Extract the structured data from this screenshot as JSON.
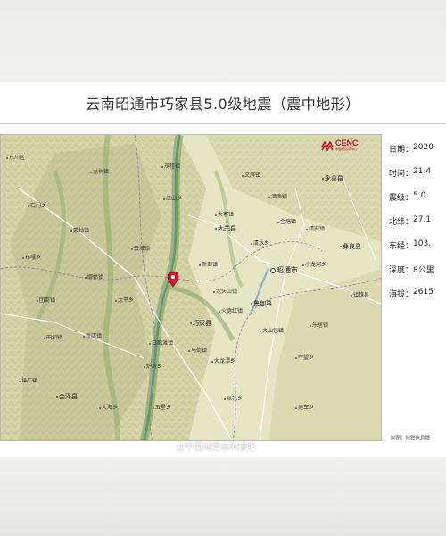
{
  "title": "云南昭通市巧家县5.0级地震（震中地形）",
  "logo": {
    "abbr": "CENC",
    "sub": "中国地震台网中心",
    "icon": "cenc-logo-icon"
  },
  "info": [
    {
      "key": "日期",
      "sep": "：",
      "value": "2020"
    },
    {
      "key": "时间",
      "sep": "：",
      "value": "21:4"
    },
    {
      "key": "震级",
      "sep": "：",
      "value": "5.0"
    },
    {
      "key": "北纬",
      "sep": "：",
      "value": "27.1"
    },
    {
      "key": "东经",
      "sep": "：",
      "value": "103."
    },
    {
      "key": "深度",
      "sep": "：",
      "value": "8公里"
    },
    {
      "key": "海拔",
      "sep": "：",
      "value": "2615"
    }
  ],
  "credit": "制图：地震信息播",
  "watermark": "@中国地震台网速报",
  "map": {
    "epicenter_icon": "epicenter-marker-icon",
    "colors": {
      "lowland": "#e6e6c4",
      "highland": "#c9c89a",
      "valley": "#6f9a55",
      "water": "#9fc4dc",
      "road": "#ffffff",
      "epicenter": "#d4142b"
    },
    "places": {
      "zhaotong": "昭通市",
      "qiaojia": "巧家县",
      "huize": "会泽县",
      "dongchuan": "东川区",
      "ludian": "鲁甸县",
      "yongshan": "永善县",
      "daguan": "大关县",
      "yiliang": "彝良县",
      "zhenxiong": "镇雄县",
      "yuncheng": "云城镇",
      "mengzi": "蒙姑镇",
      "baihetan": "白鹤滩镇",
      "dazhai": "大寨镇",
      "xinjie": "新街镇",
      "maotian": "茂租镇",
      "longshu": "龙树镇",
      "wenping": "文屏镇",
      "jintang": "金塘镇",
      "hongshan": "红山乡",
      "qingshui": "清水乡",
      "longtou": "龙头山镇",
      "huodong": "火德红镇",
      "xiaolongdong": "小龙洞乡",
      "jinghai": "靖安镇",
      "shibeng": "石门乡",
      "tuanjie": "团街镇",
      "yangjiang": "洒渔镇",
      "taiping": "太平乡",
      "lexiang": "乐居镇",
      "buga": "布嘎乡",
      "tianba": "田坝镇",
      "dashan": "大山包镇",
      "chaotong2": "守望乡",
      "dayao": "大龙潭乡",
      "lugang": "炉房乡",
      "madian": "马街镇",
      "xinpu": "新店镇",
      "jiaogou": "铅厂镇",
      "dahaizi": "大海乡",
      "wuxing": "五星乡",
      "yilong": "以礼乡",
      "gongshan": "拖车乡",
      "chayuan": "娜姑镇"
    }
  }
}
